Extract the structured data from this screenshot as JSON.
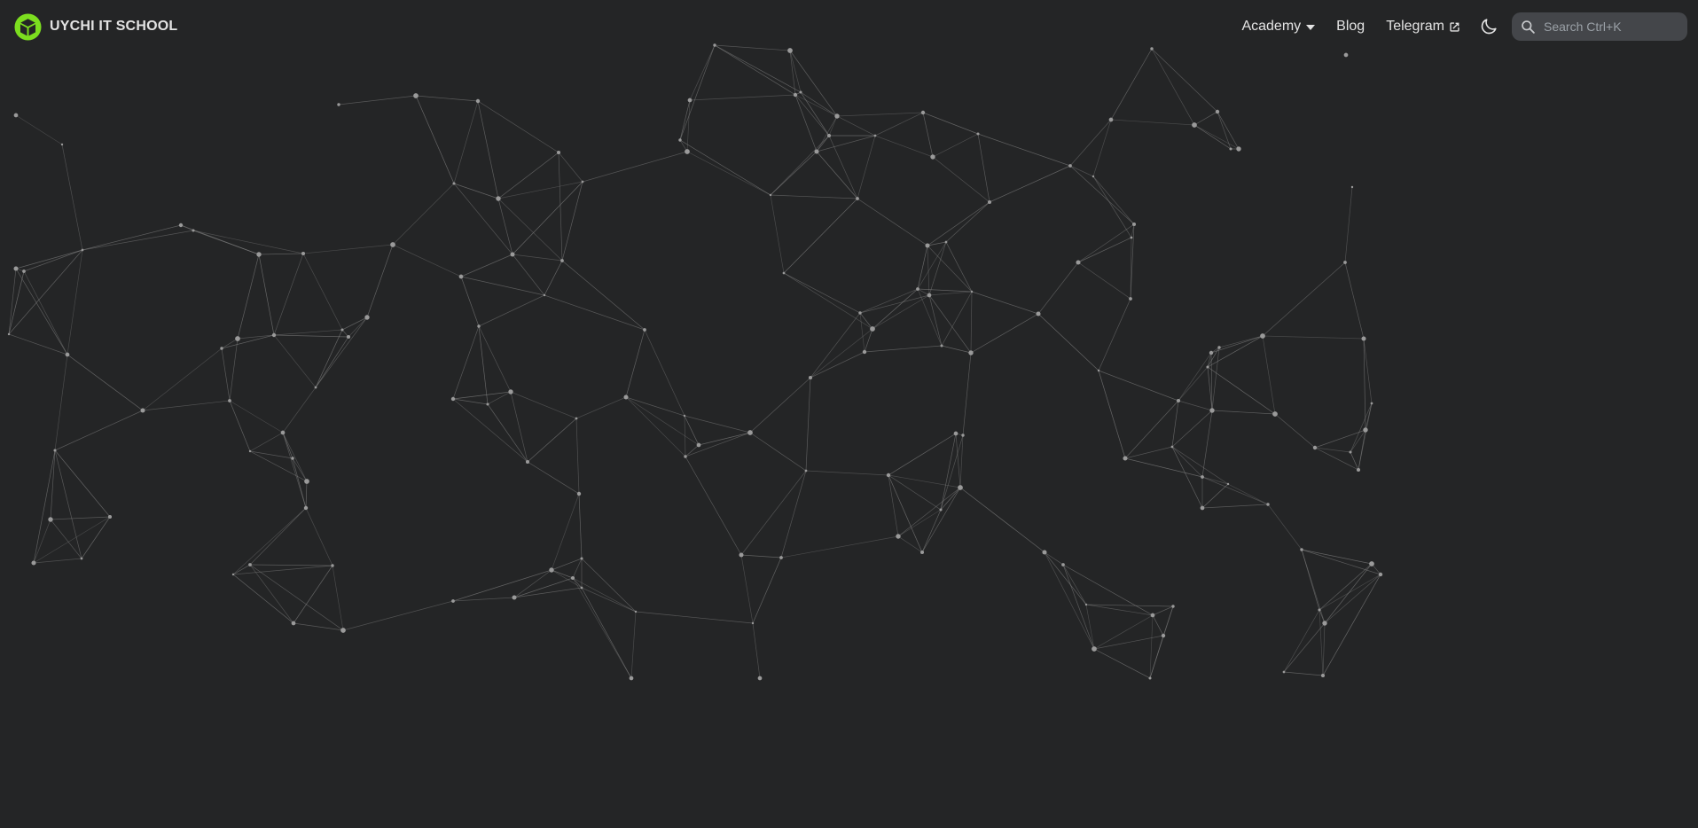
{
  "colors": {
    "background": "#242526",
    "brand_green": "#7cde1f",
    "text": "#e3e3e3",
    "search_bg": "#44464a"
  },
  "navbar": {
    "brand": {
      "logo_icon": "cube-logo-icon",
      "title": "UYCHI IT SCHOOL"
    },
    "items": [
      {
        "label": "Academy",
        "icon": "caret-down-icon"
      },
      {
        "label": "Blog"
      },
      {
        "label": "Telegram",
        "icon": "external-link-icon"
      }
    ],
    "theme_toggle_icon": "moon-icon",
    "search": {
      "icon": "search-icon",
      "placeholder": "Search Ctrl+K"
    }
  },
  "background": {
    "type": "particle-network",
    "dot_color": "#9a9a9a",
    "line_color": "#8a8a8a"
  }
}
